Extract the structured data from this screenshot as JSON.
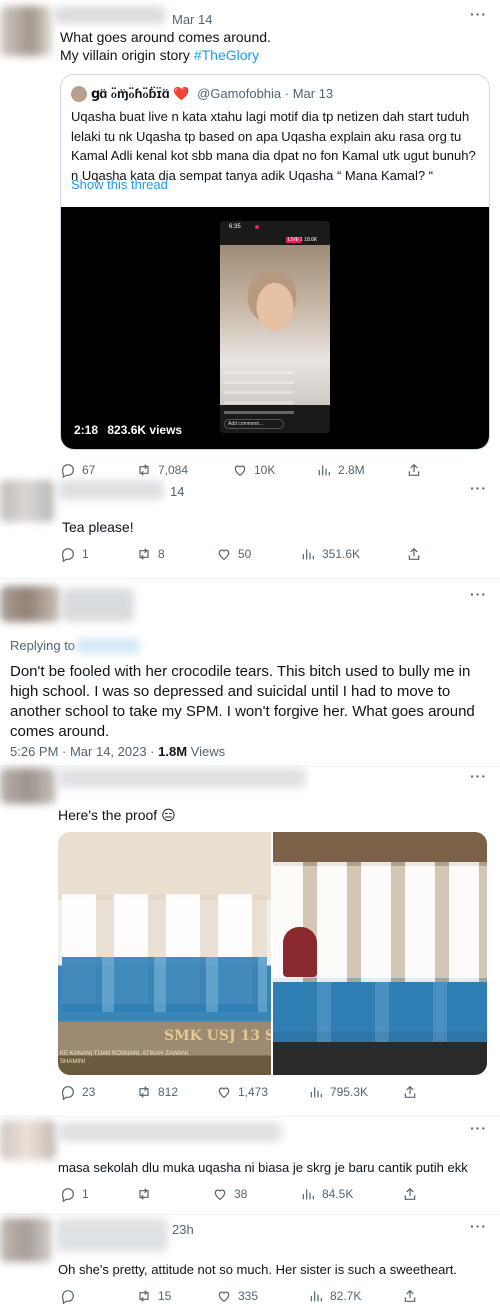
{
  "tweet1": {
    "time": "Mar 14",
    "text_line1": "What goes around comes around.",
    "text_line2": "My villain origin story ",
    "hashtag": "#TheGlory",
    "quote": {
      "display_name": "ցɑ̈ ℴ̈ɱ̈ℴ̈ɦℴ̈ɓ̈ɪ̈ɑ̈ ❤️",
      "handle_date": "@Gamofobhia · Mar 13",
      "text": "Uqasha buat live n kata xtahu lagi motif dia tp netizen dah start tuduh lelaki tu nk Uqasha tp based on apa Uqasha explain aku rasa org tu Kamal Adli kenal kot sbb mana dia dpat no fon Kamal utk ugut bunuh? n Uqasha kata dia sempat tanya adik Uqasha “ Mana Kamal? “",
      "show_thread": "Show this thread",
      "video_duration": "2:18",
      "video_views": "823.6K views",
      "phone_time": "6:35",
      "live_badge": "LIVE",
      "live_count": "1 18.6K",
      "add_comment": "Add comment..."
    },
    "actions": {
      "replies": "67",
      "retweets": "7,084",
      "likes": "10K",
      "views": "2.8M"
    }
  },
  "tweet2": {
    "time": "14",
    "text": "Tea please!",
    "actions": {
      "replies": "1",
      "retweets": "8",
      "likes": "50",
      "views": "351.6K"
    }
  },
  "main_tweet": {
    "replying_to": "Replying to",
    "text": "Don't be fooled with her crocodile tears. This bitch used to bully me in high school. I was so depressed and suicidal until I had to move to another school to take my SPM. I won't forgive her. What goes around comes around.",
    "timestamp": "5:26 PM · Mar 14, 2023 · ",
    "views_count": "1.8M",
    "views_label": " Views"
  },
  "reply1": {
    "text": "Here's the proof ",
    "emoji": "😑",
    "photo_caption": "SMK USJ 13 S",
    "photo_names": "KE KANAN) TUAN ROSNANI, ATIKAH ZAWANI, SHAMINI",
    "actions": {
      "replies": "23",
      "retweets": "812",
      "likes": "1,473",
      "views": "795.3K"
    }
  },
  "reply2": {
    "text": "masa sekolah dlu muka uqasha ni biasa je skrg je baru cantik putih ekk",
    "actions": {
      "replies": "1",
      "retweets": "",
      "likes": "38",
      "views": "84.5K"
    }
  },
  "reply3": {
    "time": "23h",
    "text": "Oh she's pretty, attitude not so much. Her sister is such a sweetheart.",
    "actions": {
      "replies": "",
      "retweets": "15",
      "likes": "335",
      "views": "82.7K"
    }
  },
  "colors": {
    "link": "#1d9bf0",
    "muted": "#536471",
    "border": "#cfd9de",
    "live": "#e0245e"
  }
}
